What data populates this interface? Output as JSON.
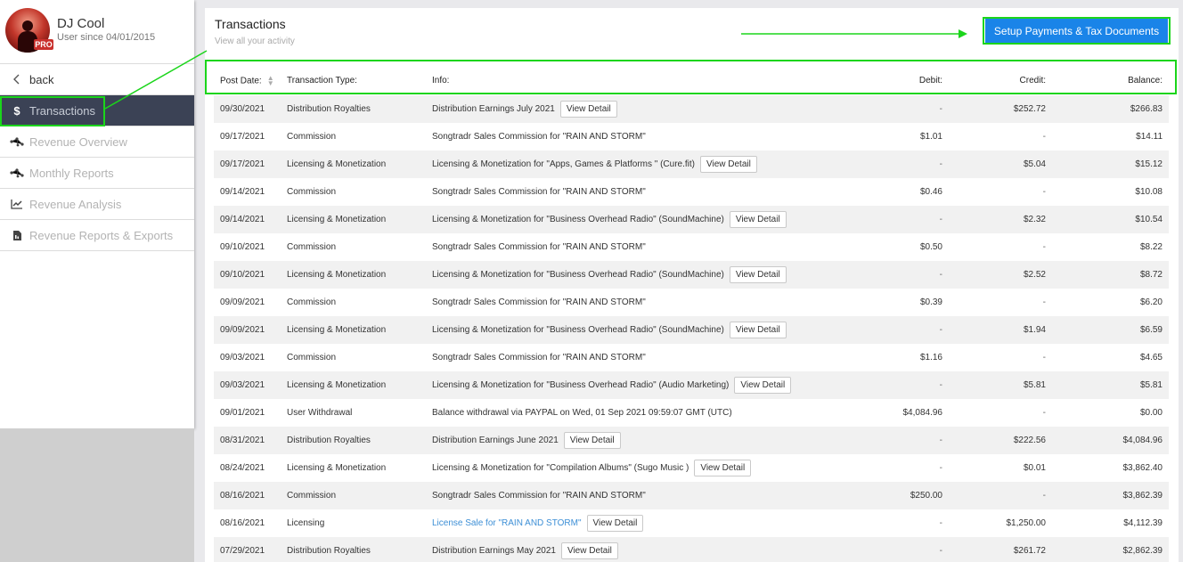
{
  "profile": {
    "name": "DJ Cool",
    "since": "User since 04/01/2015",
    "badge": "PRO"
  },
  "sidebar": {
    "back_label": "back",
    "items": [
      {
        "label": "Transactions",
        "icon": "dollar-icon",
        "glyph": "$"
      },
      {
        "label": "Revenue Overview",
        "icon": "network-icon",
        "glyph": "⁂"
      },
      {
        "label": "Monthly Reports",
        "icon": "network-icon",
        "glyph": "⁂"
      },
      {
        "label": "Revenue Analysis",
        "icon": "line-chart-icon",
        "glyph": "📈"
      },
      {
        "label": "Revenue Reports & Exports",
        "icon": "document-icon",
        "glyph": "▤"
      }
    ]
  },
  "main": {
    "title": "Transactions",
    "subtitle": "View all your activity",
    "setup_button": "Setup Payments & Tax Documents",
    "columns": [
      "Post Date:",
      "Transaction Type:",
      "Info:",
      "Debit:",
      "Credit:",
      "Balance:"
    ],
    "view_detail_label": "View Detail",
    "rows": [
      {
        "date": "09/30/2021",
        "type": "Distribution Royalties",
        "info": "Distribution Earnings July 2021",
        "detail": true,
        "link": false,
        "debit": "-",
        "credit": "$252.72",
        "balance": "$266.83"
      },
      {
        "date": "09/17/2021",
        "type": "Commission",
        "info": "Songtradr Sales Commission for \"RAIN AND STORM\"",
        "detail": false,
        "link": false,
        "debit": "$1.01",
        "credit": "-",
        "balance": "$14.11"
      },
      {
        "date": "09/17/2021",
        "type": "Licensing & Monetization",
        "info": "Licensing & Monetization for \"Apps, Games & Platforms \" (Cure.fit)",
        "detail": true,
        "link": false,
        "debit": "-",
        "credit": "$5.04",
        "balance": "$15.12"
      },
      {
        "date": "09/14/2021",
        "type": "Commission",
        "info": "Songtradr Sales Commission for \"RAIN AND STORM\"",
        "detail": false,
        "link": false,
        "debit": "$0.46",
        "credit": "-",
        "balance": "$10.08"
      },
      {
        "date": "09/14/2021",
        "type": "Licensing & Monetization",
        "info": "Licensing & Monetization for \"Business Overhead Radio\" (SoundMachine)",
        "detail": true,
        "link": false,
        "debit": "-",
        "credit": "$2.32",
        "balance": "$10.54"
      },
      {
        "date": "09/10/2021",
        "type": "Commission",
        "info": "Songtradr Sales Commission for \"RAIN AND STORM\"",
        "detail": false,
        "link": false,
        "debit": "$0.50",
        "credit": "-",
        "balance": "$8.22"
      },
      {
        "date": "09/10/2021",
        "type": "Licensing & Monetization",
        "info": "Licensing & Monetization for \"Business Overhead Radio\" (SoundMachine)",
        "detail": true,
        "link": false,
        "debit": "-",
        "credit": "$2.52",
        "balance": "$8.72"
      },
      {
        "date": "09/09/2021",
        "type": "Commission",
        "info": "Songtradr Sales Commission for \"RAIN AND STORM\"",
        "detail": false,
        "link": false,
        "debit": "$0.39",
        "credit": "-",
        "balance": "$6.20"
      },
      {
        "date": "09/09/2021",
        "type": "Licensing & Monetization",
        "info": "Licensing & Monetization for \"Business Overhead Radio\" (SoundMachine)",
        "detail": true,
        "link": false,
        "debit": "-",
        "credit": "$1.94",
        "balance": "$6.59"
      },
      {
        "date": "09/03/2021",
        "type": "Commission",
        "info": "Songtradr Sales Commission for \"RAIN AND STORM\"",
        "detail": false,
        "link": false,
        "debit": "$1.16",
        "credit": "-",
        "balance": "$4.65"
      },
      {
        "date": "09/03/2021",
        "type": "Licensing & Monetization",
        "info": "Licensing & Monetization for \"Business Overhead Radio\" (Audio Marketing)",
        "detail": true,
        "link": false,
        "debit": "-",
        "credit": "$5.81",
        "balance": "$5.81"
      },
      {
        "date": "09/01/2021",
        "type": "User Withdrawal",
        "info": "Balance withdrawal via PAYPAL on Wed, 01 Sep 2021 09:59:07 GMT (UTC)",
        "detail": false,
        "link": false,
        "debit": "$4,084.96",
        "credit": "-",
        "balance": "$0.00"
      },
      {
        "date": "08/31/2021",
        "type": "Distribution Royalties",
        "info": "Distribution Earnings June 2021",
        "detail": true,
        "link": false,
        "debit": "-",
        "credit": "$222.56",
        "balance": "$4,084.96"
      },
      {
        "date": "08/24/2021",
        "type": "Licensing & Monetization",
        "info": "Licensing & Monetization for \"Compilation Albums\" (Sugo Music )",
        "detail": true,
        "link": false,
        "debit": "-",
        "credit": "$0.01",
        "balance": "$3,862.40"
      },
      {
        "date": "08/16/2021",
        "type": "Commission",
        "info": "Songtradr Sales Commission for \"RAIN AND STORM\"",
        "detail": false,
        "link": false,
        "debit": "$250.00",
        "credit": "-",
        "balance": "$3,862.39"
      },
      {
        "date": "08/16/2021",
        "type": "Licensing",
        "info": "License Sale for \"RAIN AND STORM\"",
        "detail": true,
        "link": true,
        "debit": "-",
        "credit": "$1,250.00",
        "balance": "$4,112.39"
      },
      {
        "date": "07/29/2021",
        "type": "Distribution Royalties",
        "info": "Distribution Earnings May 2021",
        "detail": true,
        "link": false,
        "debit": "-",
        "credit": "$261.72",
        "balance": "$2,862.39"
      }
    ]
  },
  "colors": {
    "accent": "#1a84e8",
    "sidebar_active": "#3b4255",
    "highlight": "#1bd51b",
    "link": "#3d8fd6"
  }
}
